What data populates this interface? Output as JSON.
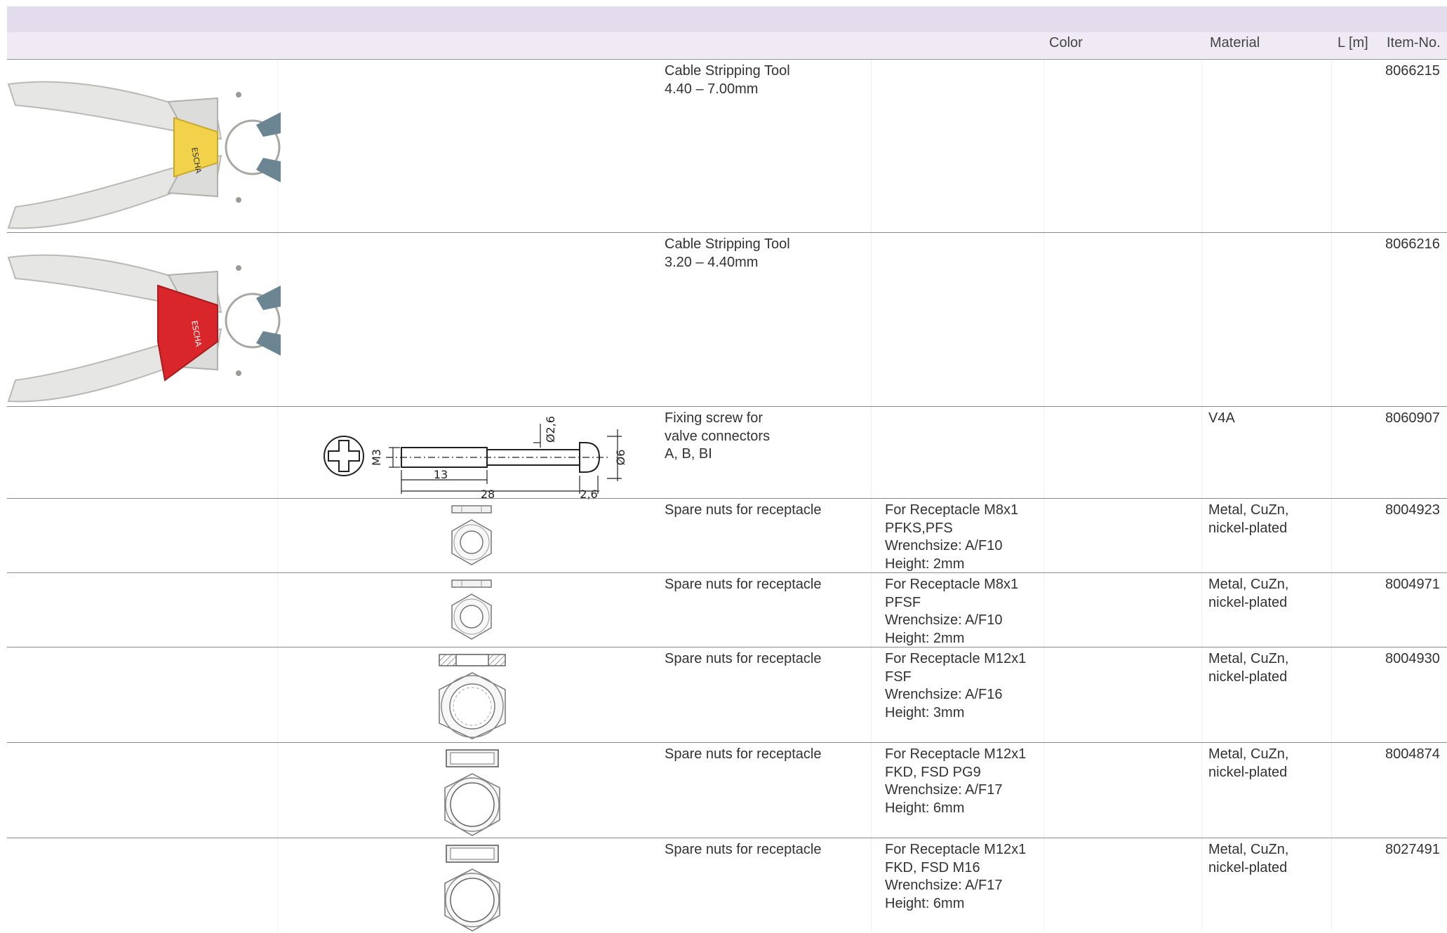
{
  "table": {
    "headers": {
      "color": "Color",
      "material": "Material",
      "length": "L [m]",
      "item_no": "Item-No."
    },
    "rows": [
      {
        "description": [
          "Cable Stripping Tool",
          "4.40 – 7.00mm"
        ],
        "specs": [],
        "color": "",
        "material": [],
        "length": "",
        "item_no": "8066215",
        "image": "cable-stripping-tool-yellow"
      },
      {
        "description": [
          "Cable Stripping Tool",
          "3.20 – 4.40mm"
        ],
        "specs": [],
        "color": "",
        "material": [],
        "length": "",
        "item_no": "8066216",
        "image": "cable-stripping-tool-red"
      },
      {
        "description": [
          "Fixing screw for",
          "valve connectors",
          "A, B, BI"
        ],
        "specs": [],
        "color": "",
        "material": [
          "V4A"
        ],
        "length": "",
        "item_no": "8060907",
        "image": "fixing-screw-drawing",
        "drawing_labels": {
          "m": "M3",
          "d1": "Ø2,6",
          "d2": "Ø6",
          "l1": "13",
          "l2": "28",
          "l3": "2,6"
        }
      },
      {
        "description": [
          "Spare nuts for receptacle"
        ],
        "specs": [
          "For Receptacle M8x1",
          "PFKS,PFS",
          "Wrenchsize: A/F10",
          "Height: 2mm"
        ],
        "color": "",
        "material": [
          "Metal, CuZn,",
          "nickel-plated"
        ],
        "length": "",
        "item_no": "8004923",
        "image": "hex-nut-small"
      },
      {
        "description": [
          "Spare nuts for receptacle"
        ],
        "specs": [
          "For Receptacle M8x1",
          "PFSF",
          "Wrenchsize: A/F10",
          "Height: 2mm"
        ],
        "color": "",
        "material": [
          "Metal, CuZn,",
          "nickel-plated"
        ],
        "length": "",
        "item_no": "8004971",
        "image": "hex-nut-small"
      },
      {
        "description": [
          "Spare nuts for receptacle"
        ],
        "specs": [
          "For Receptacle M12x1",
          "FSF",
          "Wrenchsize: A/F16",
          "Height: 3mm"
        ],
        "color": "",
        "material": [
          "Metal, CuZn,",
          "nickel-plated"
        ],
        "length": "",
        "item_no": "8004930",
        "image": "hex-nut-medium"
      },
      {
        "description": [
          "Spare nuts for receptacle"
        ],
        "specs": [
          "For Receptacle M12x1",
          "FKD, FSD PG9",
          "Wrenchsize: A/F17",
          "Height: 6mm"
        ],
        "color": "",
        "material": [
          "Metal, CuZn,",
          "nickel-plated"
        ],
        "length": "",
        "item_no": "8004874",
        "image": "hex-nut-large"
      },
      {
        "description": [
          "Spare nuts for receptacle"
        ],
        "specs": [
          "For Receptacle M12x1",
          "FKD, FSD M16",
          "Wrenchsize: A/F17",
          "Height: 6mm"
        ],
        "color": "",
        "material": [
          "Metal, CuZn,",
          "nickel-plated"
        ],
        "length": "",
        "item_no": "8027491",
        "image": "hex-nut-large"
      }
    ]
  },
  "colors": {
    "header_band_top": "#e2dcec",
    "header_band": "#efeaf4",
    "row_divider": "#8a8a8a",
    "tool_label_yellow": "#f1d24a",
    "tool_label_red": "#d8262b"
  }
}
